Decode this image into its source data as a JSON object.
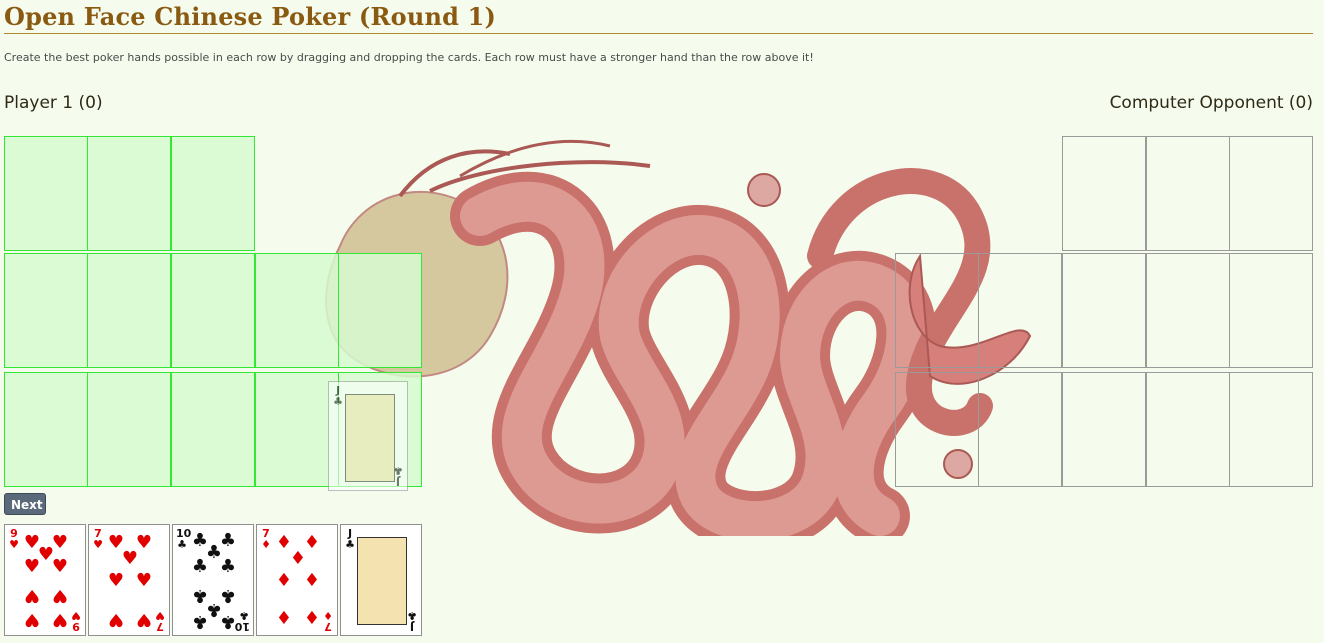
{
  "page": {
    "title": "Open Face Chinese Poker (Round 1)",
    "instructions": "Create the best poker hands possible in each row by dragging and dropping the cards. Each row must have a stronger hand than the row above it!"
  },
  "players": {
    "player": "Player 1 (0)",
    "opponent": "Computer Opponent (0)"
  },
  "controls": {
    "next_label": "Next"
  },
  "board": {
    "player_rows": [
      3,
      5,
      5
    ],
    "opponent_rows": [
      3,
      5,
      5
    ],
    "dragging_card": {
      "rank": "J",
      "suit": "♣",
      "color": "black"
    }
  },
  "hand": [
    {
      "rank": "9",
      "suit": "♥",
      "color": "red"
    },
    {
      "rank": "7",
      "suit": "♥",
      "color": "red"
    },
    {
      "rank": "10",
      "suit": "♣",
      "color": "black"
    },
    {
      "rank": "7",
      "suit": "♦",
      "color": "red"
    },
    {
      "rank": "J",
      "suit": "♣",
      "color": "black"
    }
  ],
  "colors": {
    "player_slot": "#33e833",
    "opponent_slot": "#9a9a9a",
    "dragon": "#c0504d",
    "title": "#8a5a12"
  }
}
